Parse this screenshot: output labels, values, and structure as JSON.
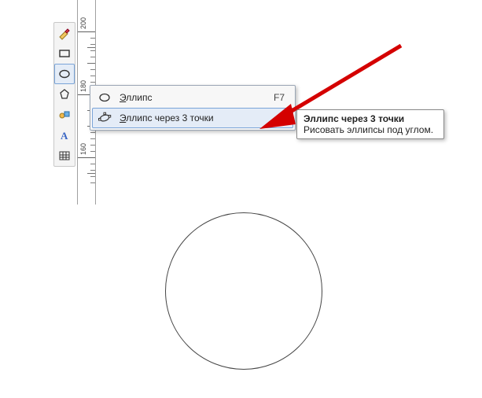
{
  "ruler": {
    "labels": [
      "200",
      "180",
      "160"
    ]
  },
  "toolbox": {
    "tools": [
      {
        "name": "freehand-tool"
      },
      {
        "name": "rectangle-tool"
      },
      {
        "name": "ellipse-tool",
        "active": true
      },
      {
        "name": "polygon-tool"
      },
      {
        "name": "shapes-tool"
      },
      {
        "name": "text-tool"
      },
      {
        "name": "table-tool"
      }
    ]
  },
  "flyout": {
    "items": [
      {
        "label": "Эллипс",
        "underline_index": 0,
        "shortcut": "F7",
        "icon": "ellipse-icon"
      },
      {
        "label": "Эллипс через 3 точки",
        "underline_index": 0,
        "shortcut": "",
        "icon": "ellipse-3pt-icon",
        "hover": true
      }
    ]
  },
  "tooltip": {
    "title": "Эллипс через 3 точки",
    "body": "Рисовать эллипсы под углом."
  }
}
